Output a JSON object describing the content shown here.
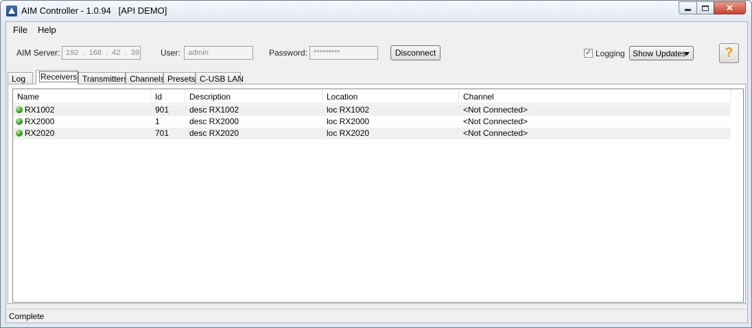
{
  "window": {
    "title": "AIM Controller - 1.0.94   [API DEMO]"
  },
  "menu": [
    "File",
    "Help"
  ],
  "connection": {
    "server_label": "AIM Server:",
    "server_value": "192  .  168  .  42  .  39",
    "user_label": "User:",
    "user_value": "admin",
    "password_label": "Password:",
    "password_value": "*********",
    "disconnect_label": "Disconnect",
    "logging_label": "Logging",
    "logging_checked": true,
    "show_updates": "Show Updates",
    "help_glyph": "?"
  },
  "tabs": [
    "Log",
    "Receivers",
    "Transmitters",
    "Channels",
    "Presets",
    "C-USB LAN"
  ],
  "active_tab": "Receivers",
  "table": {
    "columns": [
      "Name",
      "Id",
      "Description",
      "Location",
      "Channel"
    ],
    "rows": [
      {
        "name": "RX1002",
        "id": "901",
        "description": "desc RX1002",
        "location": "loc RX1002",
        "channel": "<Not Connected>",
        "status_color": "#2f9b1a"
      },
      {
        "name": "RX2000",
        "id": "1",
        "description": "desc RX2000",
        "location": "loc RX2000",
        "channel": "<Not Connected>",
        "status_color": "#2f9b1a"
      },
      {
        "name": "RX2020",
        "id": "701",
        "description": "desc RX2020",
        "location": "loc RX2020",
        "channel": "<Not Connected>",
        "status_color": "#2f9b1a"
      }
    ]
  },
  "status": {
    "text": "Complete"
  },
  "icons": {
    "app": "app-logo-icon",
    "minimize": "minimize-icon",
    "maximize": "maximize-icon",
    "close": "close-icon",
    "help": "help-question-icon",
    "status": "status-online-icon"
  }
}
